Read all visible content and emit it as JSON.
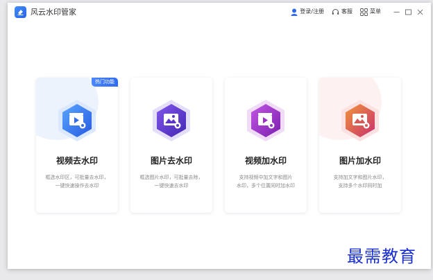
{
  "app": {
    "title": "风云水印管家"
  },
  "titlebar": {
    "login_label": "登录/注册",
    "service_label": "客服",
    "menu_label": "菜单",
    "icons": [
      "user-icon",
      "headset-icon",
      "grid-menu-icon",
      "minimize-icon",
      "maximize-icon",
      "close-icon"
    ]
  },
  "cards": [
    {
      "title": "视频去水印",
      "desc1": "框选水印区，可批量去水印，",
      "desc2": "一键快速操作去水印",
      "badge": "热门功能",
      "icon": "video-remove-icon",
      "colors": [
        "#4d9bff",
        "#2a62e8"
      ],
      "blob": "#dbe8ff"
    },
    {
      "title": "图片去水印",
      "desc1": "框选图片水印，可批量去除，",
      "desc2": "一键快速去水印",
      "icon": "image-remove-icon",
      "colors": [
        "#7b4fe0",
        "#4a2bb8"
      ],
      "blob": ""
    },
    {
      "title": "视频加水印",
      "desc1": "支持视频中加文字和图片",
      "desc2": "水印，多个位置同时加水印",
      "icon": "video-add-icon",
      "colors": [
        "#b347d9",
        "#7f22b3"
      ],
      "blob": ""
    },
    {
      "title": "图片加水印",
      "desc1": "支持加文字和图片水印，",
      "desc2": "支持多个水印同时加",
      "icon": "image-add-icon",
      "colors": [
        "#f0883d",
        "#c9396b"
      ],
      "blob": "#fde4e4"
    }
  ],
  "watermark": "最需教育"
}
